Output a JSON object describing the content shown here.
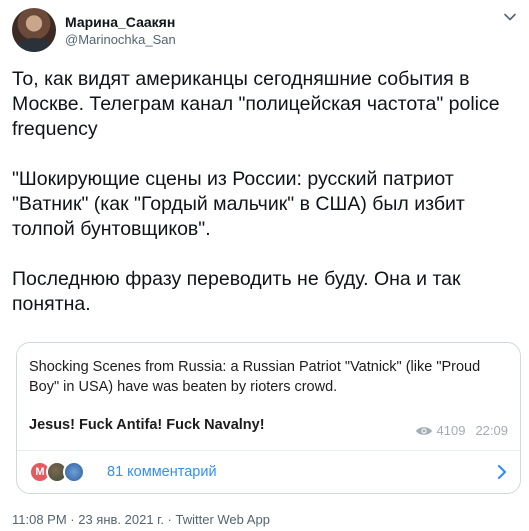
{
  "author": {
    "display_name": "Марина_Саакян",
    "handle": "@Marinochka_San"
  },
  "tweet": {
    "paragraphs": [
      "То, как видят американцы сегодняшние события в Москве. Телеграм канал \"полицейская частота\" police frequency",
      "\"Шокирующие сцены из России: русский патриот \"Ватник\" (как \"Гордый мальчик\" в США) был избит толпой бунтовщиков\".",
      "Последнюю фразу переводить не буду. Она и так понятна."
    ]
  },
  "telegram_card": {
    "message": "Shocking Scenes from Russia: a Russian Patriot \"Vatnick\" (like \"Proud Boy\" in USA) have was beaten by rioters crowd.",
    "bold_line": "Jesus! Fuck Antifa! Fuck Navalny!",
    "views": "4109",
    "time": "22:09",
    "comments_label": "81 комментарий",
    "first_avatar_letter": "M"
  },
  "meta": {
    "timestamp": "11:08 PM · 23 янв. 2021 г. · Twitter Web App"
  },
  "colors": {
    "accent": "#3390ec",
    "muted": "#536471",
    "meta_gray": "#a2acb4",
    "avatar_red": "#e35b60"
  },
  "icons": {
    "caret": "chevron-down-icon",
    "eye": "eye-icon",
    "chevron": "chevron-right-icon"
  }
}
